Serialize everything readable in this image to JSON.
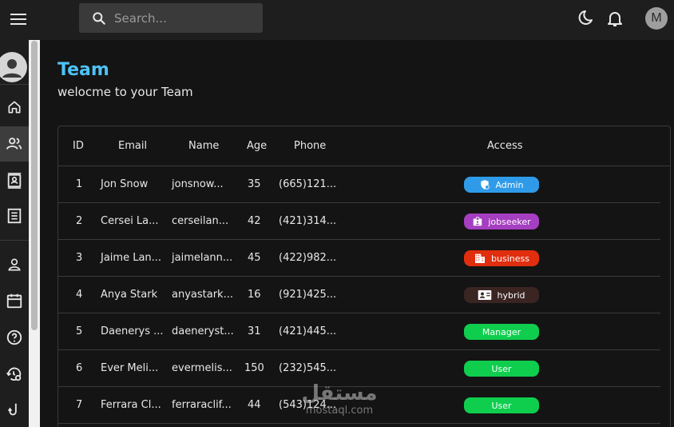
{
  "topbar": {
    "search_placeholder": "Search...",
    "avatar_letter": "M",
    "icons": [
      "menu-icon",
      "search-icon",
      "moon-icon",
      "bell-icon"
    ]
  },
  "sidebar": {
    "items": [
      "profile-avatar",
      "home-icon",
      "team-icon",
      "contacts-icon",
      "invoices-icon",
      "person-icon",
      "calendar-icon",
      "help-icon",
      "history-settings-icon",
      "hook-icon"
    ],
    "active": "team-icon"
  },
  "page": {
    "title": "Team",
    "subtitle": "welocme to your Team"
  },
  "table": {
    "headers": {
      "id": "ID",
      "email": "Email",
      "name": "Name",
      "age": "Age",
      "phone": "Phone",
      "access": "Access"
    },
    "rows": [
      {
        "id": "1",
        "email": "Jon Snow",
        "name": "jonsnow...",
        "age": "35",
        "phone": "(665)121...",
        "access": "Admin",
        "access_icon": "admin-icon",
        "color": "#2f9be8"
      },
      {
        "id": "2",
        "email": "Cersei La...",
        "name": "cerseilan...",
        "age": "42",
        "phone": "(421)314...",
        "access": "jobseeker",
        "access_icon": "badge-icon",
        "color": "#a53ec0"
      },
      {
        "id": "3",
        "email": "Jaime Lan...",
        "name": "jaimelann...",
        "age": "45",
        "phone": "(422)982...",
        "access": "business",
        "access_icon": "building-icon",
        "color": "#e02e0e"
      },
      {
        "id": "4",
        "email": "Anya Stark",
        "name": "anyastark...",
        "age": "16",
        "phone": "(921)425...",
        "access": "hybrid",
        "access_icon": "contact-card-icon",
        "color": "#3a2523"
      },
      {
        "id": "5",
        "email": "Daenerys ...",
        "name": "daeneryst...",
        "age": "31",
        "phone": "(421)445...",
        "access": "Manager",
        "access_icon": "",
        "color": "#0fce4e"
      },
      {
        "id": "6",
        "email": "Ever Meli...",
        "name": "evermelis...",
        "age": "150",
        "phone": "(232)545...",
        "access": "User",
        "access_icon": "",
        "color": "#0fce4e"
      },
      {
        "id": "7",
        "email": "Ferrara Cl...",
        "name": "ferraraclif...",
        "age": "44",
        "phone": "(543)124...",
        "access": "User",
        "access_icon": "",
        "color": "#0fce4e"
      }
    ]
  },
  "watermark": {
    "arabic": "مستقل",
    "latin": "mostaql.com"
  }
}
